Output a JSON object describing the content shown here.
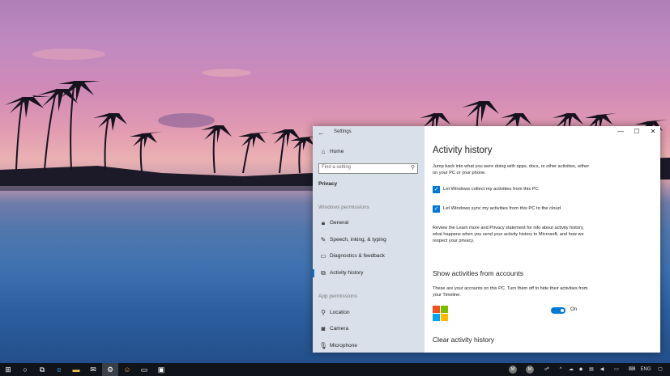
{
  "window": {
    "title": "Settings",
    "back_icon": "back-arrow-icon",
    "controls": {
      "minimize": "—",
      "maximize": "☐",
      "close": "✕"
    }
  },
  "nav": {
    "home": "Home",
    "search_placeholder": "Find a setting",
    "section_title": "Privacy",
    "windows_permissions_label": "Windows permissions",
    "windows_items": [
      {
        "label": "General",
        "icon": "lock-icon"
      },
      {
        "label": "Speech, inking, & typing",
        "icon": "speech-icon"
      },
      {
        "label": "Diagnostics & feedback",
        "icon": "feedback-icon"
      },
      {
        "label": "Activity history",
        "icon": "timeline-icon",
        "active": true
      }
    ],
    "app_permissions_label": "App permissions",
    "app_items": [
      {
        "label": "Location",
        "icon": "location-icon"
      },
      {
        "label": "Camera",
        "icon": "camera-icon"
      },
      {
        "label": "Microphone",
        "icon": "microphone-icon"
      }
    ]
  },
  "main": {
    "title": "Activity history",
    "intro": "Jump back into what you were doing with apps, docs, or other activities, either on your PC or your phone.",
    "checkbox_collect": "Let Windows collect my activities from this PC",
    "checkbox_sync": "Let Windows sync my activities from this PC to the cloud",
    "review_text": "Review the Learn more and Privacy statement for info about activity history, what happens when you send your activity history to Microsoft, and how we respect your privacy.",
    "accounts_heading": "Show activities from accounts",
    "accounts_text": "These are your accounts on this PC. Turn them off to hide their activities from your Timeline.",
    "toggle_label": "On",
    "clear_heading": "Clear activity history"
  },
  "taskbar": {
    "avatar_1": "M",
    "avatar_2": "M",
    "language": "ENG"
  },
  "colors": {
    "accent": "#0078d7",
    "ms_red": "#f25022",
    "ms_green": "#7fba00",
    "ms_blue": "#00a4ef",
    "ms_yellow": "#ffb900"
  }
}
